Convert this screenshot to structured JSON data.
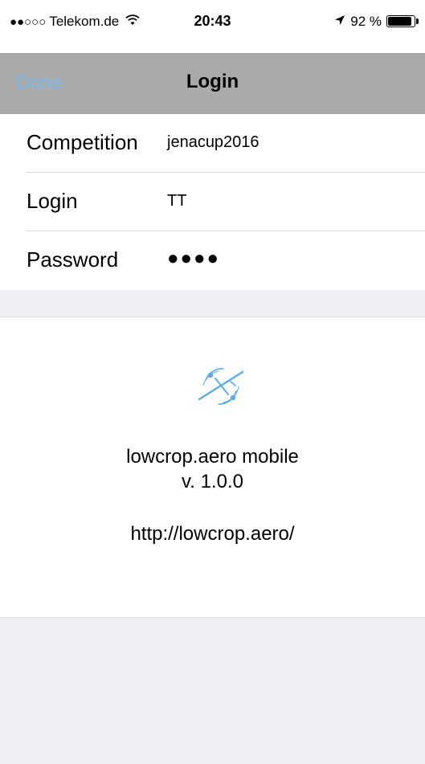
{
  "status_bar": {
    "signal": "●●○○○",
    "carrier": "Telekom.de",
    "wifi_icon": "wifi-icon",
    "time": "20:43",
    "location_icon": "location-arrow-icon",
    "battery_text": "92 %",
    "battery_level": 0.92
  },
  "nav_bar": {
    "done_label": "Done",
    "title": "Login",
    "done_color": "#7ab8ee",
    "background": "#aaaaaa"
  },
  "form": {
    "competition": {
      "label": "Competition",
      "value": "jenacup2016"
    },
    "login": {
      "label": "Login",
      "value": "TT"
    },
    "password": {
      "label": "Password",
      "value": "●●●●"
    }
  },
  "about": {
    "logo_icon": "glider-logo-icon",
    "app_name": "lowcrop.aero mobile",
    "version": "v. 1.0.0",
    "url": "http://lowcrop.aero/",
    "logo_color": "#5aaee6"
  }
}
